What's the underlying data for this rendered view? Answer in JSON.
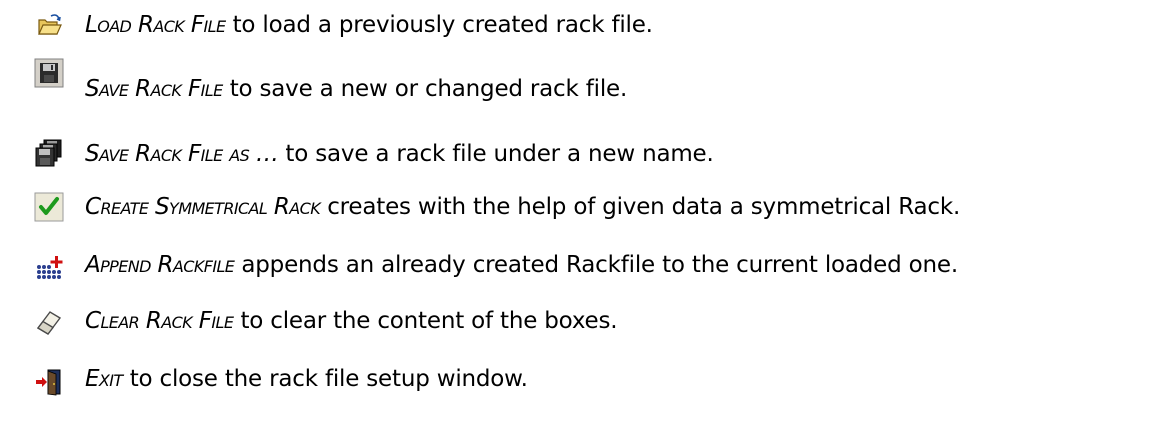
{
  "items": [
    {
      "icon": "open-folder-icon",
      "command": "Load Rack File",
      "text": " to load a previously created rack file."
    },
    {
      "icon": "floppy-disk-icon",
      "command": "Save Rack File",
      "text": " to save a new or changed rack file."
    },
    {
      "icon": "save-as-disks-icon",
      "command": "Save Rack File as …",
      "text": " to save a rack file under a new name."
    },
    {
      "icon": "checkmark-icon",
      "command": "Create Symmetrical Rack",
      "text": " creates with the help of given data a symmetrical Rack."
    },
    {
      "icon": "append-grid-icon",
      "command": "Append Rackfile",
      "text": " appends an already created Rackfile to the current loaded one."
    },
    {
      "icon": "eraser-icon",
      "command": "Clear Rack File",
      "text": " to clear the content of the boxes."
    },
    {
      "icon": "exit-door-icon",
      "command": "Exit",
      "text": " to close the rack file setup window."
    }
  ]
}
